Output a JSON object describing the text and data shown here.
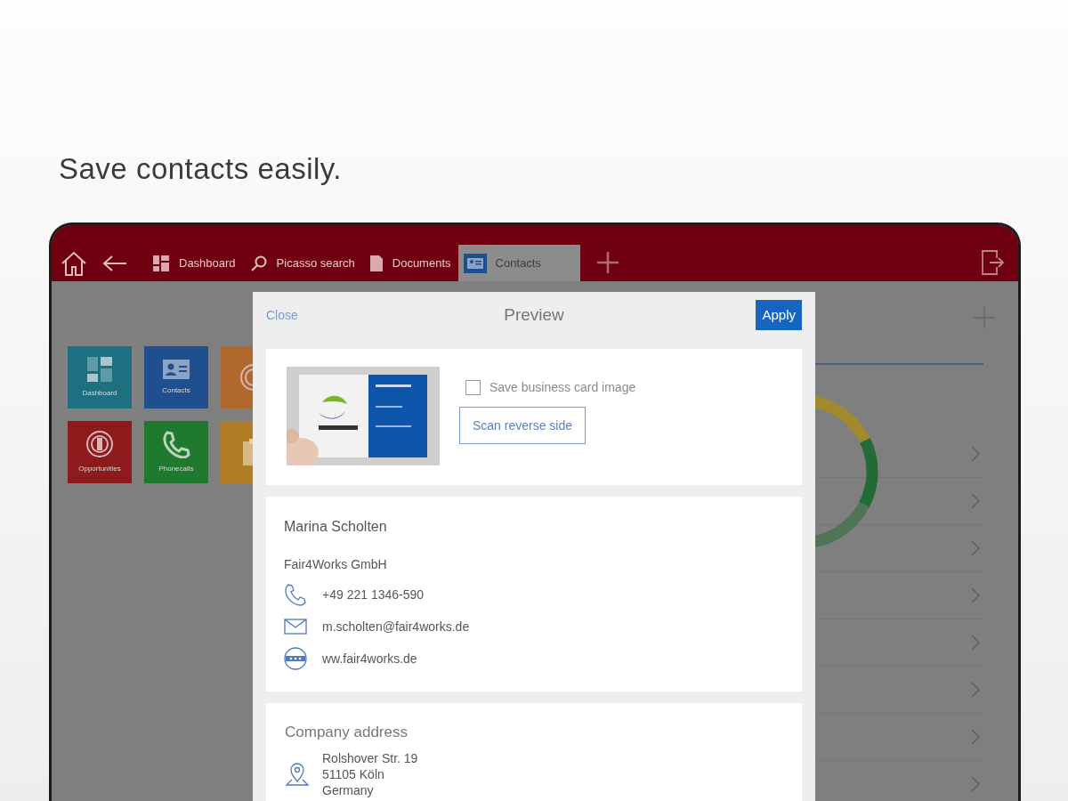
{
  "headline": "Save contacts easily.",
  "nav": {
    "tabs": [
      {
        "label": "Dashboard",
        "kind": "grid",
        "selected": false
      },
      {
        "label": "Picasso search",
        "kind": "search",
        "selected": false
      },
      {
        "label": "Documents",
        "kind": "document",
        "selected": false
      },
      {
        "label": "Contacts",
        "kind": "card",
        "selected": true
      }
    ]
  },
  "tiles": [
    {
      "label": "Dashboard",
      "kind": "grid",
      "color": "#1e6f80"
    },
    {
      "label": "Contacts",
      "kind": "card",
      "color": "#1f4f8c"
    },
    {
      "kind": "target",
      "color": "#b0692c"
    },
    {
      "label": "Opportunities",
      "kind": "target",
      "color": "#8e1b1b"
    },
    {
      "label": "Phonecalls",
      "kind": "phone",
      "color": "#1f7a30"
    },
    {
      "kind": "clipboard",
      "color": "#b07c24"
    }
  ],
  "side_rows": [
    {
      "kind": "chevron"
    },
    {
      "kind": "chevron"
    },
    {
      "kind": "chevron"
    },
    {
      "kind": "chevron"
    },
    {
      "kind": "chevron"
    },
    {
      "kind": "chevron"
    },
    {
      "kind": "chevron"
    },
    {
      "kind": "chevron"
    }
  ],
  "modal": {
    "close": "Close",
    "title": "Preview",
    "apply": "Apply",
    "save_image": {
      "label": "Save business card image",
      "checked": false
    },
    "scan_button": "Scan reverse side",
    "contact": {
      "name": "Marina Scholten",
      "company": "Fair4Works GmbH",
      "details": [
        {
          "kind": "phone",
          "text": "+49 221 1346-590"
        },
        {
          "kind": "email",
          "text": "m.scholten@fair4works.de"
        },
        {
          "kind": "web",
          "text": "ww.fair4works.de"
        }
      ]
    },
    "address": {
      "title": "Company address",
      "lines": [
        "Rolshover Str. 19",
        "51105 Köln",
        "Germany"
      ]
    }
  }
}
